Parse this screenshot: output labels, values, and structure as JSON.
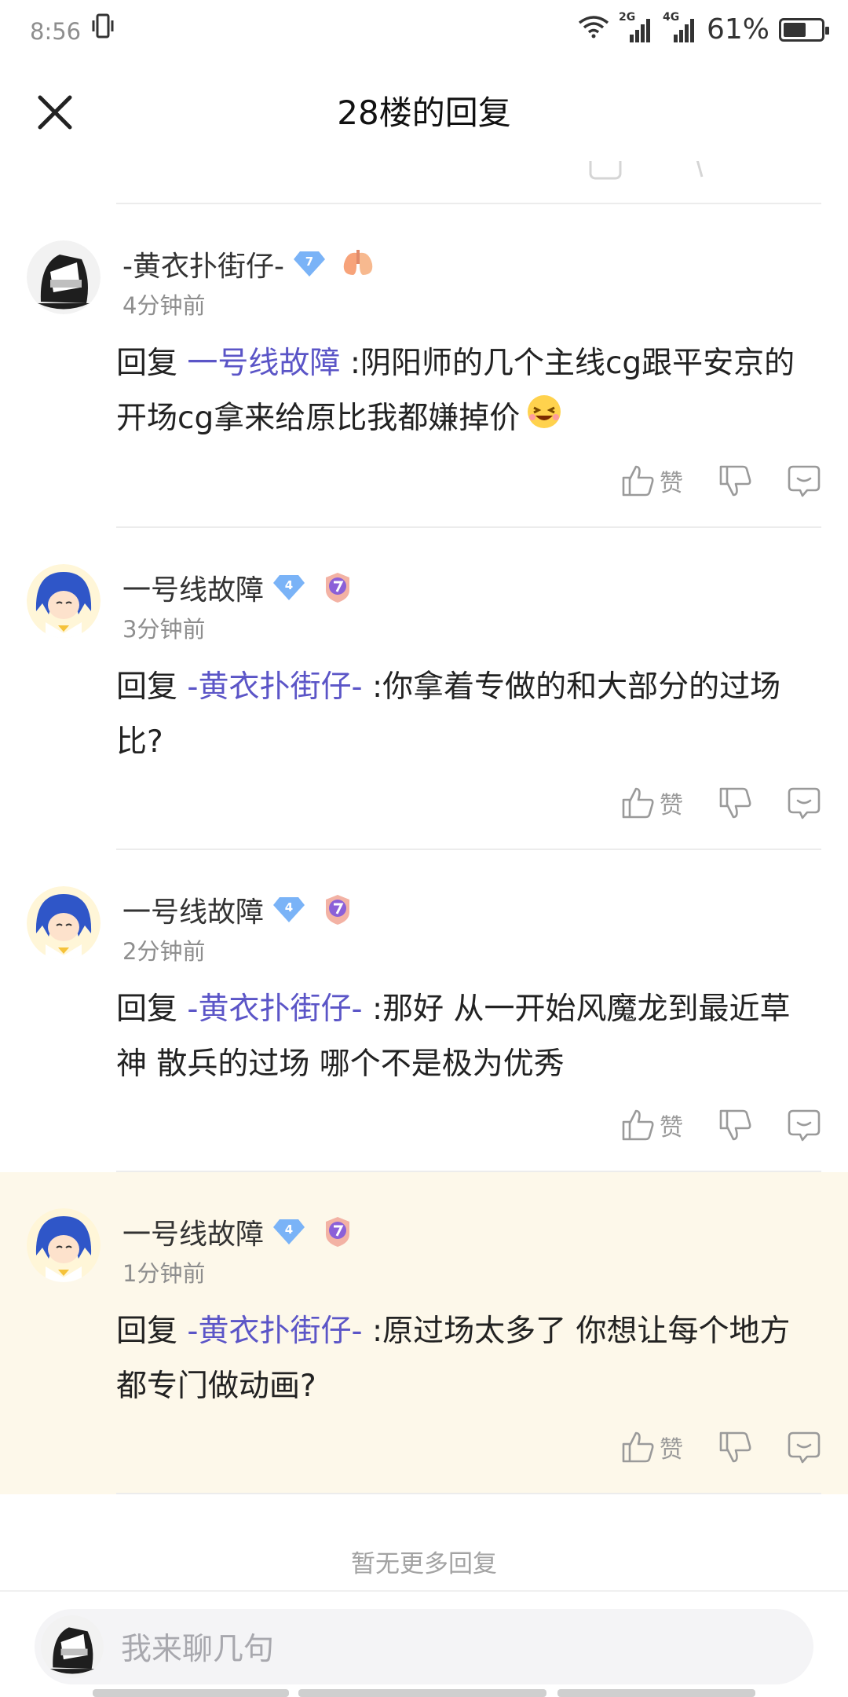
{
  "status_bar": {
    "time": "8:56",
    "network_2g": "2G",
    "network_4g": "4G",
    "battery": "61%",
    "battery_level": 0.61
  },
  "header": {
    "title": "28楼的回复"
  },
  "comments": [
    {
      "name": "-黄衣扑街仔-",
      "level": "7",
      "time": "4分钟前",
      "reply_prefix": "回复 ",
      "reply_to": "一号线故障",
      "text": " :阴阳师的几个主线cg跟平安京的开场cg拿来给原比我都嫌掉价",
      "like_label": "赞",
      "highlight": false
    },
    {
      "name": "一号线故障",
      "level": "4",
      "time": "3分钟前",
      "reply_prefix": "回复 ",
      "reply_to": "-黄衣扑街仔-",
      "text": " :你拿着专做的和大部分的过场比?",
      "like_label": "赞",
      "highlight": false
    },
    {
      "name": "一号线故障",
      "level": "4",
      "time": "2分钟前",
      "reply_prefix": "回复 ",
      "reply_to": "-黄衣扑街仔-",
      "text": " :那好 从一开始风魔龙到最近草神 散兵的过场 哪个不是极为优秀",
      "like_label": "赞",
      "highlight": false
    },
    {
      "name": "一号线故障",
      "level": "4",
      "time": "1分钟前",
      "reply_prefix": "回复 ",
      "reply_to": "-黄衣扑街仔-",
      "text": " :原过场太多了 你想让每个地方都专门做动画?",
      "like_label": "赞",
      "highlight": true
    }
  ],
  "list_footer": "暂无更多回复",
  "composer": {
    "placeholder": "我来聊几句"
  },
  "colors": {
    "link": "#5b55c7",
    "highlight_bg": "#fdf8ea"
  }
}
